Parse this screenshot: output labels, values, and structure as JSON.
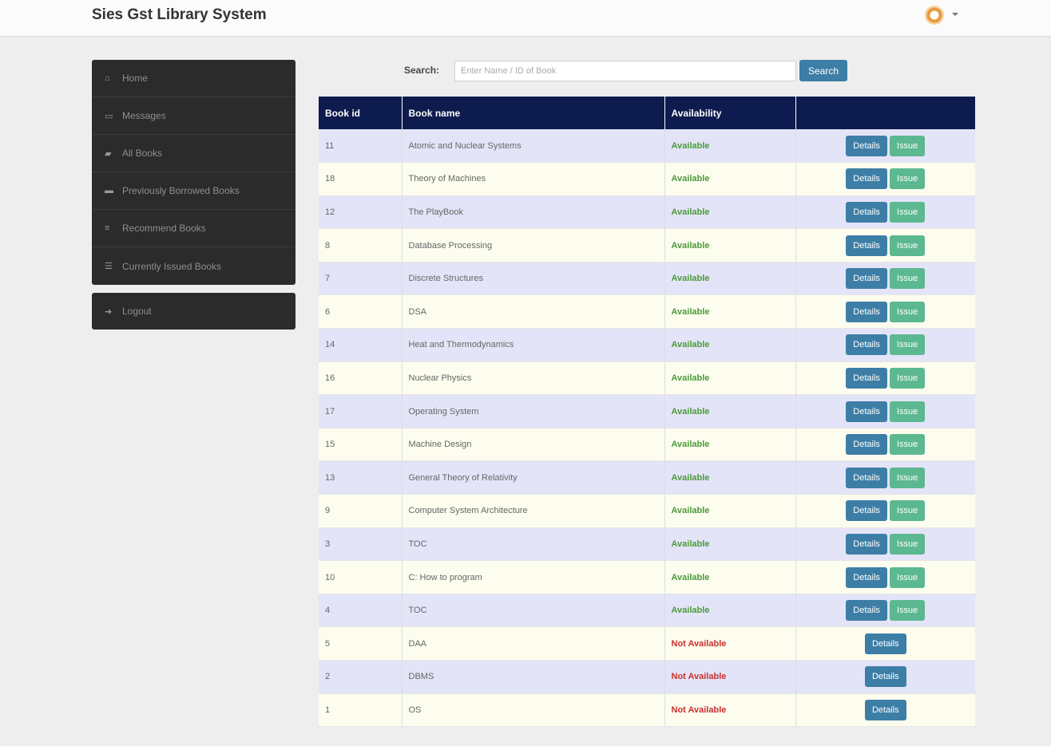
{
  "header": {
    "brand": "Sies Gst Library System"
  },
  "sidebar": {
    "items": [
      {
        "label": "Home",
        "icon": "home-icon",
        "glyph": "⌂"
      },
      {
        "label": "Messages",
        "icon": "inbox-icon",
        "glyph": "▭"
      },
      {
        "label": "All Books",
        "icon": "book-icon",
        "glyph": "▰"
      },
      {
        "label": "Previously Borrowed Books",
        "icon": "folder-icon",
        "glyph": "▬"
      },
      {
        "label": "Recommend Books",
        "icon": "list-icon",
        "glyph": "≡"
      },
      {
        "label": "Currently Issued Books",
        "icon": "grid-list-icon",
        "glyph": "☰"
      }
    ],
    "logout": {
      "label": "Logout",
      "icon": "logout-icon",
      "glyph": "➜"
    }
  },
  "search": {
    "label": "Search:",
    "placeholder": "Enter Name / ID of Book",
    "value": "",
    "button": "Search"
  },
  "table": {
    "headers": [
      "Book id",
      "Book name",
      "Availability",
      ""
    ],
    "details_label": "Details",
    "issue_label": "Issue",
    "rows": [
      {
        "id": "11",
        "name": "Atomic and Nuclear Systems",
        "availability": "Available",
        "available": true
      },
      {
        "id": "18",
        "name": "Theory of Machines",
        "availability": "Available",
        "available": true
      },
      {
        "id": "12",
        "name": "The PlayBook",
        "availability": "Available",
        "available": true
      },
      {
        "id": "8",
        "name": "Database Processing",
        "availability": "Available",
        "available": true
      },
      {
        "id": "7",
        "name": "Discrete Structures",
        "availability": "Available",
        "available": true
      },
      {
        "id": "6",
        "name": "DSA",
        "availability": "Available",
        "available": true
      },
      {
        "id": "14",
        "name": "Heat and Thermodynamics",
        "availability": "Available",
        "available": true
      },
      {
        "id": "16",
        "name": "Nuclear Physics",
        "availability": "Available",
        "available": true
      },
      {
        "id": "17",
        "name": "Operating System",
        "availability": "Available",
        "available": true
      },
      {
        "id": "15",
        "name": "Machine Design",
        "availability": "Available",
        "available": true
      },
      {
        "id": "13",
        "name": "General Theory of Relativity",
        "availability": "Available",
        "available": true
      },
      {
        "id": "9",
        "name": "Computer System Architecture",
        "availability": "Available",
        "available": true
      },
      {
        "id": "3",
        "name": "TOC",
        "availability": "Available",
        "available": true
      },
      {
        "id": "10",
        "name": "C: How to program",
        "availability": "Available",
        "available": true
      },
      {
        "id": "4",
        "name": "TOC",
        "availability": "Available",
        "available": true
      },
      {
        "id": "5",
        "name": "DAA",
        "availability": "Not Available",
        "available": false
      },
      {
        "id": "2",
        "name": "DBMS",
        "availability": "Not Available",
        "available": false
      },
      {
        "id": "1",
        "name": "OS",
        "availability": "Not Available",
        "available": false
      }
    ]
  },
  "colors": {
    "header_bg": "#0d1b4e",
    "details": "#3d7ea6",
    "issue": "#5cb890",
    "available": "#4a9a3a",
    "not_available": "#c9302c"
  }
}
